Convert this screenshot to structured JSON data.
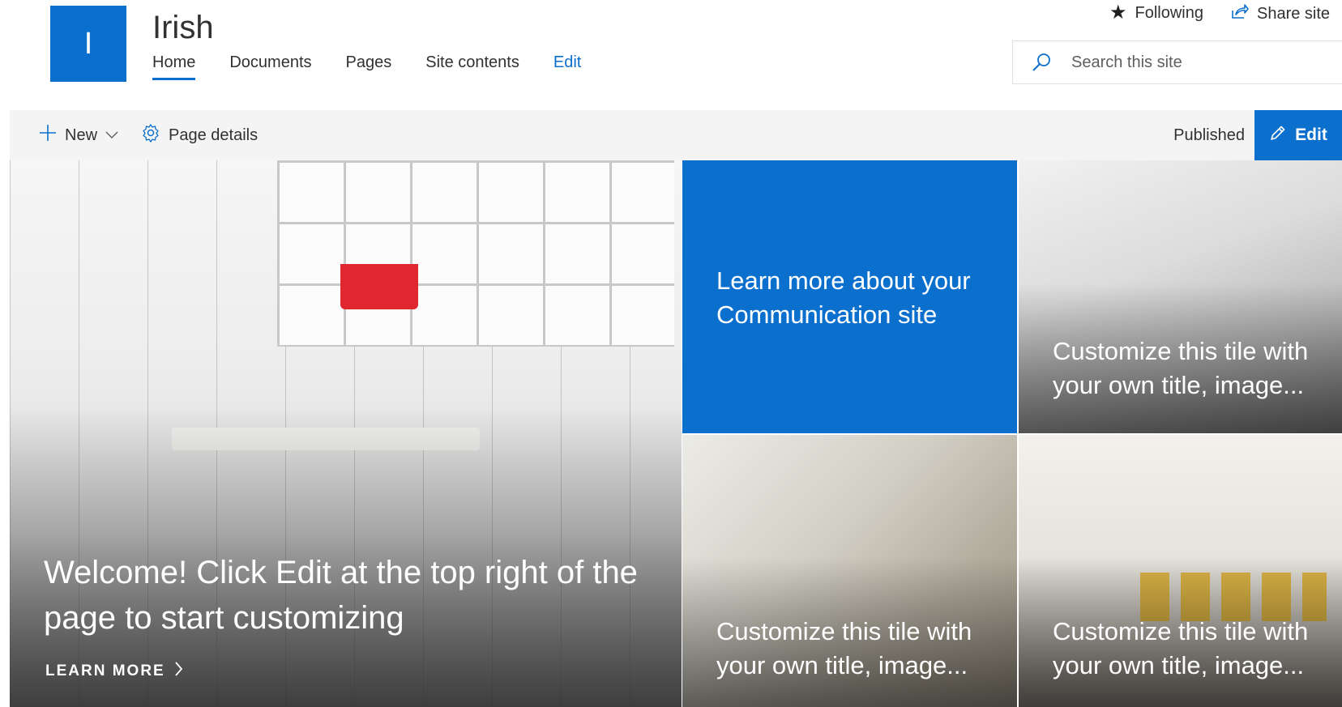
{
  "site": {
    "logo_letter": "I",
    "title": "Irish",
    "nav": [
      {
        "label": "Home",
        "active": true
      },
      {
        "label": "Documents"
      },
      {
        "label": "Pages"
      },
      {
        "label": "Site contents"
      },
      {
        "label": "Edit"
      }
    ],
    "following_label": "Following",
    "share_label": "Share site",
    "search_placeholder": "Search this site"
  },
  "command_bar": {
    "new_label": "New",
    "page_details_label": "Page details",
    "status": "Published",
    "edit_label": "Edit"
  },
  "hero": {
    "main": {
      "title": "Welcome! Click Edit at the top right of the page to start customizing",
      "link_label": "LEARN MORE"
    },
    "tiles": [
      {
        "text": "Learn more about your Communication site"
      },
      {
        "text": "Customize this tile with your own title, image..."
      },
      {
        "text": "Customize this tile with your own title, image..."
      },
      {
        "text": "Customize this tile with your own title, image..."
      }
    ]
  },
  "colors": {
    "accent": "#0b6fce",
    "command_bar_bg": "#f4f4f4"
  }
}
